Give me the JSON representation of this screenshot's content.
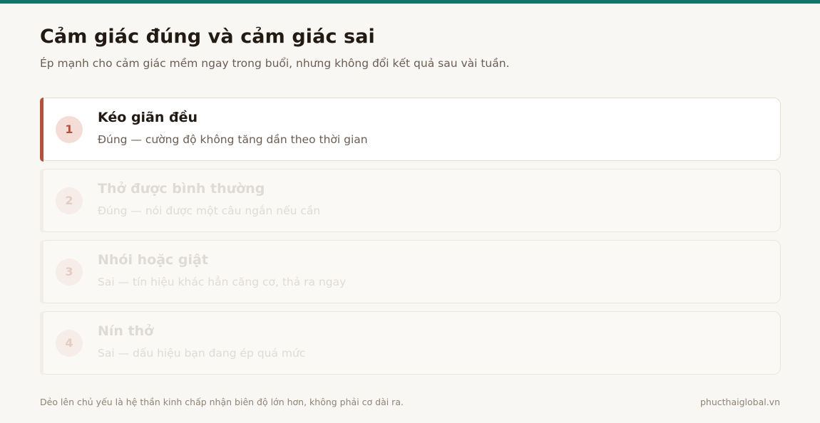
{
  "header": {
    "title": "Cảm giác đúng và cảm giác sai",
    "subtitle": "Ép mạnh cho cảm giác mềm ngay trong buổi, nhưng không đổi kết quả sau vài tuần."
  },
  "cards": [
    {
      "number": "1",
      "title": "Kéo giãn đều",
      "description": "Đúng — cường độ không tăng dần theo thời gian",
      "active": true
    },
    {
      "number": "2",
      "title": "Thở được bình thường",
      "description": "Đúng — nói được một câu ngắn nếu cần",
      "active": false
    },
    {
      "number": "3",
      "title": "Nhói hoặc giật",
      "description": "Sai — tín hiệu khác hẳn căng cơ, thả ra ngay",
      "active": false
    },
    {
      "number": "4",
      "title": "Nín thở",
      "description": "Sai — dấu hiệu bạn đang ép quá mức",
      "active": false
    }
  ],
  "footer": {
    "note": "Dẻo lên chủ yếu là hệ thần kinh chấp nhận biên độ lớn hơn, không phải cơ dài ra.",
    "site": "phucthaiglobal.vn"
  },
  "colors": {
    "top_bar": "#12776a",
    "accent": "#b4513a",
    "background": "#f9f7f3"
  }
}
